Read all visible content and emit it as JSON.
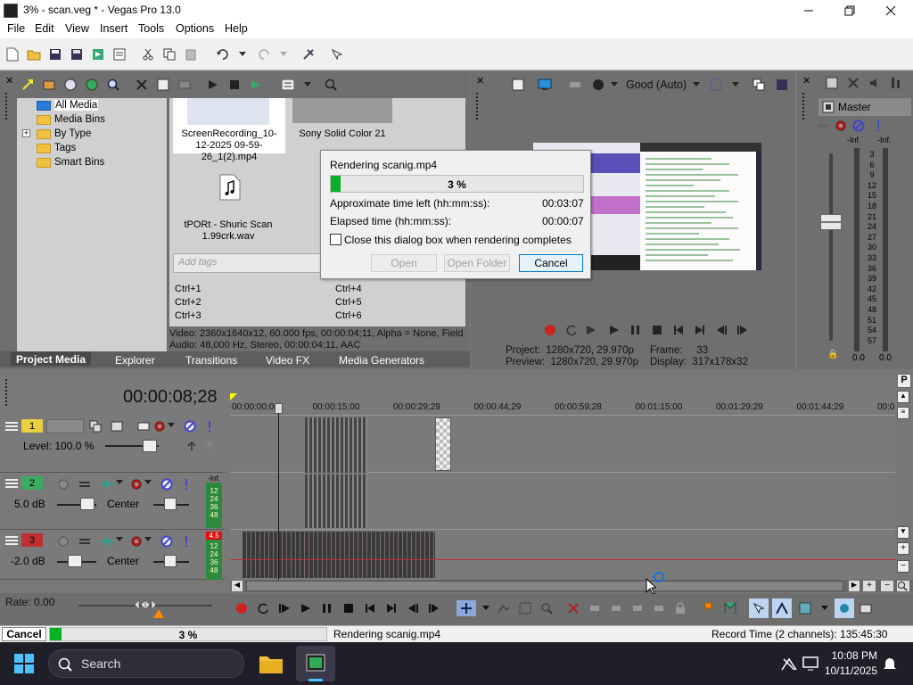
{
  "window": {
    "title": "3% - scan.veg * - Vegas Pro 13.0",
    "minimize": "—",
    "maximize": "☐",
    "close": "✕"
  },
  "menu": [
    "File",
    "Edit",
    "View",
    "Insert",
    "Tools",
    "Options",
    "Help"
  ],
  "media_tree": {
    "items": [
      {
        "label": "All Media",
        "selected": true
      },
      {
        "label": "Media Bins"
      },
      {
        "label": "By Type",
        "expander": "+"
      },
      {
        "label": "Tags"
      },
      {
        "label": "Smart Bins"
      }
    ]
  },
  "media_thumbs": {
    "clip1_name": "ScreenRecording_10-12-2025 09-59-26_1(2).mp4",
    "clip2_name": "Sony Solid Color 21",
    "clip3_name": "tPORt - Shuric Scan 1.99crk.wav",
    "tags_placeholder": "Add tags",
    "shortcuts": [
      "Ctrl+1",
      "Ctrl+2",
      "Ctrl+3",
      "Ctrl+4",
      "Ctrl+5",
      "Ctrl+6"
    ],
    "info_video": "Video: 2360x1640x12, 60.000 fps, 00:00:04;11, Alpha = None, Field",
    "info_audio": "Audio: 48,000 Hz, Stereo, 00:00:04;11, AAC"
  },
  "bottom_tabs": [
    "Project Media",
    "Explorer",
    "Transitions",
    "Video FX",
    "Media Generators"
  ],
  "preview": {
    "quality": "Good (Auto)",
    "project_label": "Project:",
    "project_value": "1280x720, 29.970p",
    "preview_label": "Preview:",
    "preview_value": "1280x720, 29.970p",
    "frame_label": "Frame:",
    "frame_value": "33",
    "display_label": "Display:",
    "display_value": "317x178x32"
  },
  "master": {
    "title": "Master",
    "left_peak": "-Inf.",
    "right_peak": "-Inf.",
    "scale": [
      "3",
      "6",
      "9",
      "12",
      "15",
      "18",
      "21",
      "24",
      "27",
      "30",
      "33",
      "36",
      "39",
      "42",
      "45",
      "48",
      "51",
      "54",
      "57"
    ],
    "left_level": "0.0",
    "right_level": "0.0"
  },
  "dialog": {
    "title": "Rendering scanig.mp4",
    "progress_text": "3 %",
    "progress_fraction": 0.03,
    "time_left_label": "Approximate time left (hh:mm:ss):",
    "time_left_value": "00:03:07",
    "elapsed_label": "Elapsed time (hh:mm:ss):",
    "elapsed_value": "00:00:07",
    "close_checkbox_label": "Close this dialog box when rendering completes",
    "open_button": "Open",
    "open_folder_button": "Open Folder",
    "cancel_button": "Cancel"
  },
  "timeline": {
    "timecode": "00:00:08;28",
    "ruler": [
      "00:00:00;00",
      "00:00:15;00",
      "00:00:29;29",
      "00:00:44;29",
      "00:00:59;28",
      "00:01:15;00",
      "00:01:29;29",
      "00:01:44;29",
      "00:0"
    ],
    "tracks": [
      {
        "number": "1",
        "type": "video",
        "level": "Level: 100.0 %"
      },
      {
        "number": "2",
        "type": "audio",
        "volume": "5.0 dB",
        "pan": "Center",
        "meter_top": "-Inf.",
        "meter_vals": [
          "12",
          "24",
          "36",
          "48"
        ]
      },
      {
        "number": "3",
        "type": "audio",
        "volume": "-2.0 dB",
        "pan": "Center",
        "meter_top": "4.5",
        "meter_vals": [
          "12",
          "24",
          "36",
          "48"
        ]
      }
    ],
    "rate": "Rate: 0.00"
  },
  "status": {
    "cancel": "Cancel",
    "progress_text": "3 %",
    "progress_fraction": 0.03,
    "message": "Rendering scanig.mp4",
    "record_time": "Record Time (2 channels): 135:45:30"
  },
  "taskbar": {
    "search": "Search",
    "time": "10:08 PM",
    "date": "10/11/2025"
  },
  "colors": {
    "progress_green": "#06b025",
    "track1": "#e8d040",
    "track2": "#3caa60",
    "track3": "#c03030"
  }
}
